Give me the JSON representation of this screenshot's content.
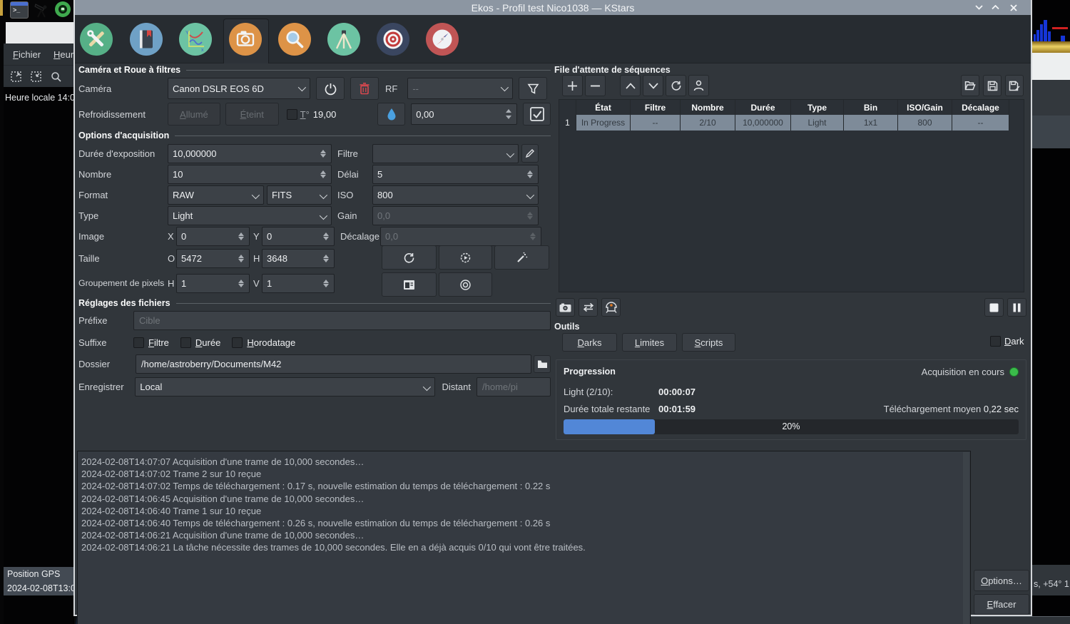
{
  "colors": {
    "titlebar": "#8c96a2",
    "window_bg": "#31363b",
    "accent_blue": "#5287d7",
    "status_green": "#3abb4a",
    "danger_red": "#d8484f",
    "selected_row": "#7e8b99"
  },
  "desktop": {
    "top_icons": [
      "terminal-icon",
      "telescope-icon",
      "kstars-logo-icon"
    ],
    "kstars_background": {
      "menu_items": [
        "Fichier",
        "Heure"
      ],
      "toolbar_icons": [
        "zoom-in-icon",
        "zoom-out-icon",
        "search-icon"
      ],
      "local_time_label": "Heure locale 14:0",
      "gps_label": "Position GPS",
      "gps_time": "2024-02-08T13:0",
      "status_fragment": "s, +54° 1"
    }
  },
  "window": {
    "title": "Ekos - Profil test Nico1038 — KStars",
    "controls": [
      "shade-icon",
      "maximize-icon",
      "close-icon"
    ]
  },
  "modules": [
    "setup",
    "scheduler",
    "analyze",
    "capture",
    "focus",
    "mount",
    "guide",
    "align"
  ],
  "active_module": "capture",
  "camera_section": {
    "title": "Caméra et Roue à filtres",
    "camera_label": "Caméra",
    "camera_value": "Canon DSLR EOS 6D",
    "fw_label": "RF",
    "fw_value": "--",
    "cooling_label": "Refroidissement",
    "on_label": "Allumé",
    "off_label": "Éteint",
    "temp_label": "T°",
    "temp_value": "19,00",
    "setpoint_value": "0,00"
  },
  "acquisition": {
    "title": "Options d'acquisition",
    "exposure_label": "Durée d'exposition",
    "exposure_value": "10,000000",
    "filter_label": "Filtre",
    "filter_value": "",
    "count_label": "Nombre",
    "count_value": "10",
    "delay_label": "Délai",
    "delay_value": "5",
    "format_label": "Format",
    "format_value": "RAW",
    "encoding_value": "FITS",
    "iso_label": "ISO",
    "iso_value": "800",
    "type_label": "Type",
    "type_value": "Light",
    "gain_label": "Gain",
    "gain_value": "0,0",
    "image_label": "Image",
    "x_label": "X",
    "x_value": "0",
    "y_label": "Y",
    "y_value": "0",
    "offset_label": "Décalage",
    "offset_value": "0,0",
    "size_label": "Taille",
    "w_label": "O",
    "w_value": "5472",
    "h_label": "H",
    "h_value": "3648",
    "binning_label": "Groupement de pixels",
    "bin_h_label": "H",
    "bin_h_value": "1",
    "bin_v_label": "V",
    "bin_v_value": "1"
  },
  "file_settings": {
    "title": "Réglages des fichiers",
    "prefix_label": "Préfixe",
    "prefix_placeholder": "Cible",
    "suffix_label": "Suffixe",
    "suffix_options": [
      "Filtre",
      "Durée",
      "Horodatage"
    ],
    "directory_label": "Dossier",
    "directory_value": "/home/astroberry/Documents/M42",
    "save_label": "Enregistrer",
    "save_value": "Local",
    "remote_label": "Distant",
    "remote_placeholder": "/home/pi"
  },
  "sequence_queue": {
    "title": "File d'attente de séquences",
    "columns": [
      "État",
      "Filtre",
      "Nombre",
      "Durée",
      "Type",
      "Bin",
      "ISO/Gain",
      "Décalage"
    ],
    "rows": [
      {
        "num": "1",
        "etat": "In Progress",
        "filtre": "--",
        "nombre": "2/10",
        "duree": "10,000000",
        "type": "Light",
        "bin": "1x1",
        "iso": "800",
        "decalage": "--"
      }
    ]
  },
  "tools": {
    "title": "Outils",
    "buttons": [
      "Darks",
      "Limites",
      "Scripts"
    ],
    "dark_label": "Dark"
  },
  "progress": {
    "title": "Progression",
    "status": "Acquisition en cours",
    "exposure_label": "Light  (2/10):",
    "exposure_value": "00:00:07",
    "remaining_label": "Durée totale restante",
    "remaining_value": "00:01:59",
    "download_label": "Téléchargement moyen",
    "download_value": "0,22 sec",
    "percent": "20%"
  },
  "log": {
    "lines": [
      "2024-02-08T14:07:07 Acquisition d'une trame  de 10,000 secondes…",
      "2024-02-08T14:07:02 Trame 2 sur 10 reçue",
      "2024-02-08T14:07:02 Temps de téléchargement : 0.17 s, nouvelle estimation du temps de téléchargement : 0.22 s",
      "2024-02-08T14:06:45 Acquisition d'une trame  de 10,000 secondes…",
      "2024-02-08T14:06:40 Trame 1 sur 10 reçue",
      "2024-02-08T14:06:40 Temps de téléchargement : 0.26 s, nouvelle estimation du temps de téléchargement : 0.26 s",
      "2024-02-08T14:06:21 Acquisition d'une trame  de 10,000 secondes…",
      "2024-02-08T14:06:21 La tâche nécessite des trames  de 10,000 secondes. Elle en a déjà acquis 0/10 qui vont être traitées."
    ]
  },
  "footer": {
    "options_label": "Options…",
    "clear_label": "Effacer"
  }
}
